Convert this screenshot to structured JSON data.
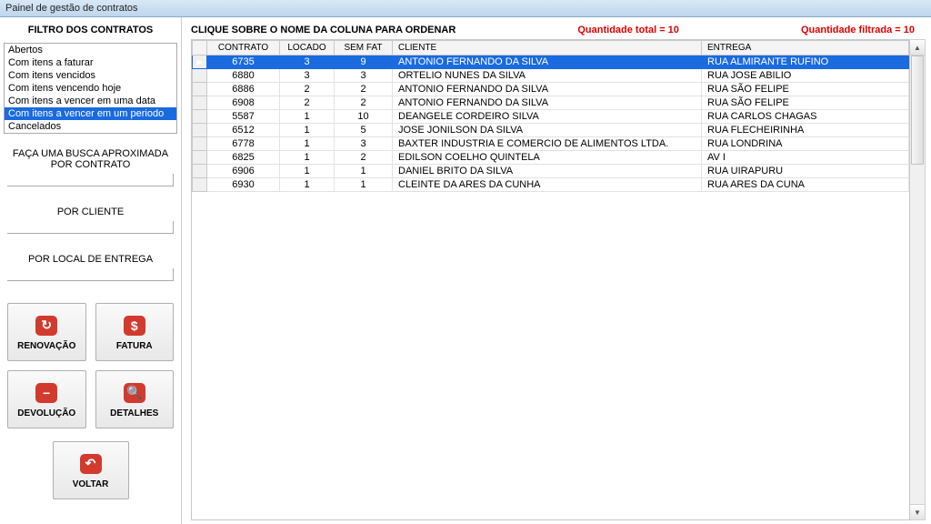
{
  "title": "Painel de gestão de contratos",
  "sidebar": {
    "filtro_title": "FILTRO DOS CONTRATOS",
    "items": [
      {
        "label": "Abertos",
        "selected": false
      },
      {
        "label": "Com itens a faturar",
        "selected": false
      },
      {
        "label": "Com itens vencidos",
        "selected": false
      },
      {
        "label": "Com itens vencendo hoje",
        "selected": false
      },
      {
        "label": "Com itens a vencer em uma data",
        "selected": false
      },
      {
        "label": "Com itens a vencer em um periodo",
        "selected": true
      },
      {
        "label": "Cancelados",
        "selected": false
      }
    ],
    "search_contrato_label": "FAÇA UMA BUSCA APROXIMADA POR CONTRATO",
    "search_cliente_label": "POR CLIENTE",
    "search_entrega_label": "POR LOCAL DE ENTREGA",
    "buttons": {
      "renovacao": "RENOVAÇÃO",
      "fatura": "FATURA",
      "devolucao": "DEVOLUÇÃO",
      "detalhes": "DETALHES",
      "voltar": "VOLTAR"
    }
  },
  "main": {
    "order_hint": "CLIQUE SOBRE O NOME DA COLUNA PARA ORDENAR",
    "qty_total": "Quantidade total = 10",
    "qty_filtrada": "Quantidade filtrada = 10",
    "columns": {
      "contrato": "CONTRATO",
      "locado": "LOCADO",
      "semfat": "SEM FAT",
      "cliente": "CLIENTE",
      "entrega": "ENTREGA"
    },
    "rows": [
      {
        "contrato": "6735",
        "locado": "3",
        "semfat": "9",
        "cliente": "ANTONIO FERNANDO DA SILVA",
        "entrega": "RUA ALMIRANTE RUFINO",
        "selected": true
      },
      {
        "contrato": "6880",
        "locado": "3",
        "semfat": "3",
        "cliente": "ORTELIO NUNES DA SILVA",
        "entrega": "RUA JOSE ABILIO",
        "selected": false
      },
      {
        "contrato": "6886",
        "locado": "2",
        "semfat": "2",
        "cliente": "ANTONIO FERNANDO DA SILVA",
        "entrega": "RUA SÃO FELIPE",
        "selected": false
      },
      {
        "contrato": "6908",
        "locado": "2",
        "semfat": "2",
        "cliente": "ANTONIO FERNANDO DA SILVA",
        "entrega": "RUA SÃO FELIPE",
        "selected": false
      },
      {
        "contrato": "5587",
        "locado": "1",
        "semfat": "10",
        "cliente": "DEANGELE CORDEIRO SILVA",
        "entrega": "RUA CARLOS CHAGAS",
        "selected": false
      },
      {
        "contrato": "6512",
        "locado": "1",
        "semfat": "5",
        "cliente": "JOSE JONILSON DA SILVA",
        "entrega": "RUA FLECHEIRINHA",
        "selected": false
      },
      {
        "contrato": "6778",
        "locado": "1",
        "semfat": "3",
        "cliente": "BAXTER INDUSTRIA E COMERCIO DE ALIMENTOS LTDA.",
        "entrega": "RUA LONDRINA",
        "selected": false
      },
      {
        "contrato": "6825",
        "locado": "1",
        "semfat": "2",
        "cliente": "EDILSON COELHO QUINTELA",
        "entrega": "AV I",
        "selected": false
      },
      {
        "contrato": "6906",
        "locado": "1",
        "semfat": "1",
        "cliente": "DANIEL BRITO DA SILVA",
        "entrega": "RUA UIRAPURU",
        "selected": false
      },
      {
        "contrato": "6930",
        "locado": "1",
        "semfat": "1",
        "cliente": "CLEINTE DA ARES DA CUNHA",
        "entrega": "RUA ARES DA CUNA",
        "selected": false
      }
    ]
  }
}
